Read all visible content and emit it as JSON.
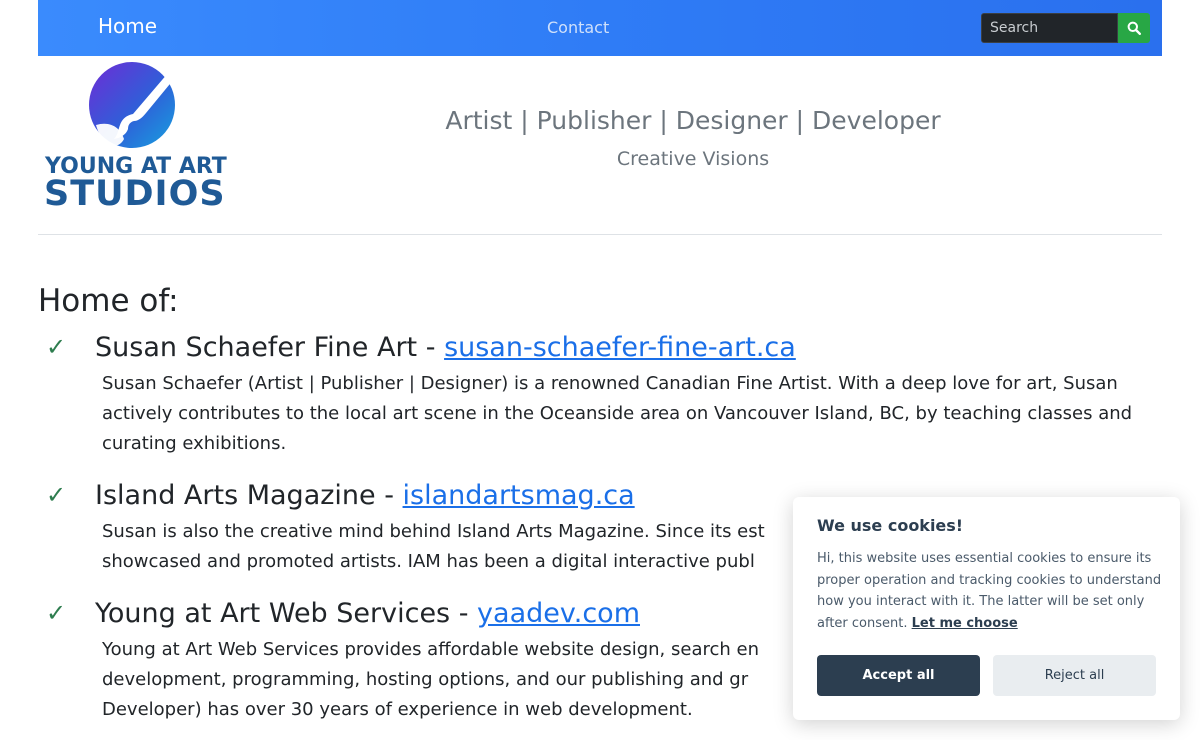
{
  "nav": {
    "home": "Home",
    "contact": "Contact",
    "search_placeholder": "Search"
  },
  "logo": {
    "line1": "YOUNG AT ART",
    "line2": "STUDIOS"
  },
  "header": {
    "tagline": "Artist | Publisher | Designer | Developer",
    "subtagline": "Creative Visions"
  },
  "main": {
    "heading": "Home of:",
    "items": [
      {
        "check": "✓",
        "title": "Susan Schaefer Fine Art - ",
        "link": "susan-schaefer-fine-art.ca",
        "description": "Susan Schaefer (Artist | Publisher | Designer) is a renowned Canadian Fine Artist. With a deep love for art, Susan actively contributes to the local art scene in the Oceanside area on Vancouver Island, BC, by teaching classes and curating exhibitions."
      },
      {
        "check": "✓",
        "title": "Island Arts Magazine - ",
        "link": "islandartsmag.ca",
        "description": "Susan is also the creative mind behind Island Arts Magazine. Since its est showcased and promoted artists. IAM has been a digital interactive publ"
      },
      {
        "check": "✓",
        "title": "Young at Art Web Services - ",
        "link": "yaadev.com",
        "description": "Young at Art Web Services provides affordable website design, search en development, programming, hosting options, and our publishing and gr Developer) has over 30 years of experience in web development."
      }
    ]
  },
  "cookie": {
    "title": "We use cookies!",
    "text": "Hi, this website uses essential cookies to ensure its proper operation and tracking cookies to understand how you interact with it. The latter will be set only after consent. ",
    "link": "Let me choose",
    "accept": "Accept all",
    "reject": "Reject all"
  },
  "colors": {
    "navbar": "#2f7cf6",
    "search_button": "#28a745",
    "link": "#1a6fe8",
    "logo": "#1f5a96",
    "cookie_accept": "#2c3e50"
  },
  "icons": {
    "search": "search-icon",
    "check": "check-icon",
    "logo": "brush-logo-icon"
  }
}
